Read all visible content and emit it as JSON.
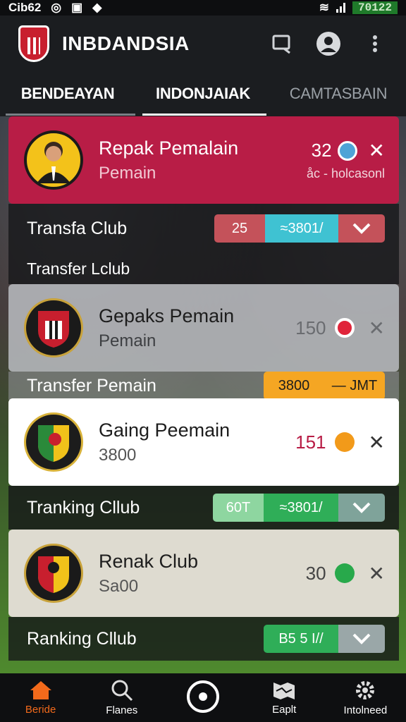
{
  "status_bar": {
    "carrier": "Cib62",
    "time": "70122"
  },
  "app_bar": {
    "title": "INBDANDSIA"
  },
  "tabs": [
    {
      "label": "BENDEAYAN"
    },
    {
      "label": "INDONJAIAK"
    },
    {
      "label": "CAMTASBAIN"
    }
  ],
  "cards": [
    {
      "name": "Repak Pemalain",
      "sub": "Pemain",
      "value": "32",
      "extra": "åc - holcasonl",
      "accent": "#4ea3d6"
    },
    {
      "name": "Gepaks Pemain",
      "sub": "Pemain",
      "value": "150",
      "accent": "#e0243a"
    },
    {
      "name": "Gaing Peemain",
      "sub": "3800",
      "value": "151",
      "accent": "#f29a1a"
    },
    {
      "name": "Renak Club",
      "sub": "Sa00",
      "value": "30",
      "accent": "#28a94b"
    }
  ],
  "rows": [
    {
      "label": "Transfa Club",
      "pill_a": "25",
      "pill_b": "≈3801/"
    },
    {
      "label": "Transfer Lclub"
    },
    {
      "label": "Transfer Pemain",
      "pill_a": "3800",
      "pill_b": "— JMT"
    },
    {
      "label": "Tranking Cllub",
      "pill_a": "60T",
      "pill_b": "≈3801/"
    },
    {
      "label": "Ranking Cllub",
      "pill_a": "B5 5 I//"
    }
  ],
  "bottom_nav": [
    {
      "label": "Beride",
      "icon": "home-icon"
    },
    {
      "label": "Flanes",
      "icon": "search-icon"
    },
    {
      "label": "",
      "icon": "record-icon"
    },
    {
      "label": "Eaplt",
      "icon": "map-icon"
    },
    {
      "label": "Intolneed",
      "icon": "gear-icon"
    }
  ],
  "colors": {
    "primary_card": "#b81d46",
    "active_nav": "#f26a1b"
  }
}
